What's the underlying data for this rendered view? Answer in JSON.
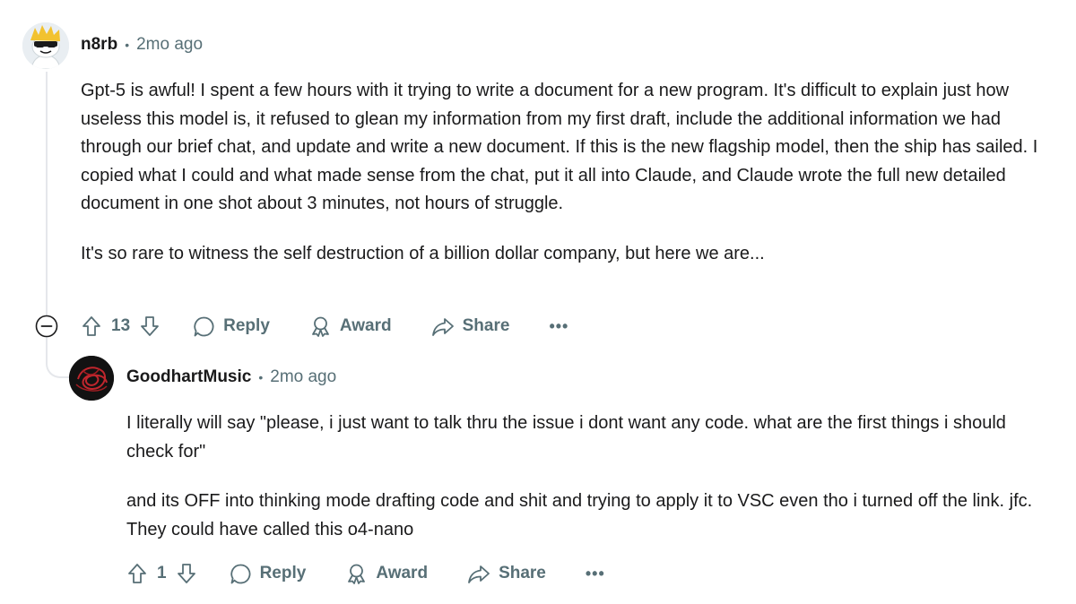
{
  "comments": [
    {
      "author": "n8rb",
      "separator": "•",
      "time": "2mo ago",
      "paragraphs": [
        "Gpt-5 is awful! I spent a few hours with it trying to write a document for a new program. It's difficult to explain just how useless this model is, it refused to glean my information from my first draft, include the additional information we had through our brief chat, and update and write a new document. If this is the new flagship model, then the ship has sailed. I copied what I could and what made sense from the chat, put it all into Claude, and Claude wrote the full new detailed document in one shot about 3 minutes, not hours of struggle.",
        "It's so rare to witness the self destruction of a billion dollar company, but here we are..."
      ],
      "votes": "13",
      "reply_label": "Reply",
      "award_label": "Award",
      "share_label": "Share",
      "more_label": "•••"
    },
    {
      "author": "GoodhartMusic",
      "separator": "•",
      "time": "2mo ago",
      "paragraphs": [
        "I literally will say \"please, i just want to talk thru the issue i dont want any code. what are the first things i should check for\"",
        "and its OFF into thinking mode drafting code and shit and trying to apply it to VSC even tho i turned off the link. jfc. They could have called this o4-nano"
      ],
      "votes": "1",
      "reply_label": "Reply",
      "award_label": "Award",
      "share_label": "Share",
      "more_label": "•••"
    }
  ],
  "icons": {
    "collapse": "minus-circle-icon",
    "upvote": "arrow-up-icon",
    "downvote": "arrow-down-icon",
    "reply": "speech-bubble-icon",
    "award": "award-icon",
    "share": "share-arrow-icon"
  },
  "colors": {
    "text": "#1a1a1b",
    "muted": "#576f76",
    "thread_line": "#e5e7eb"
  }
}
